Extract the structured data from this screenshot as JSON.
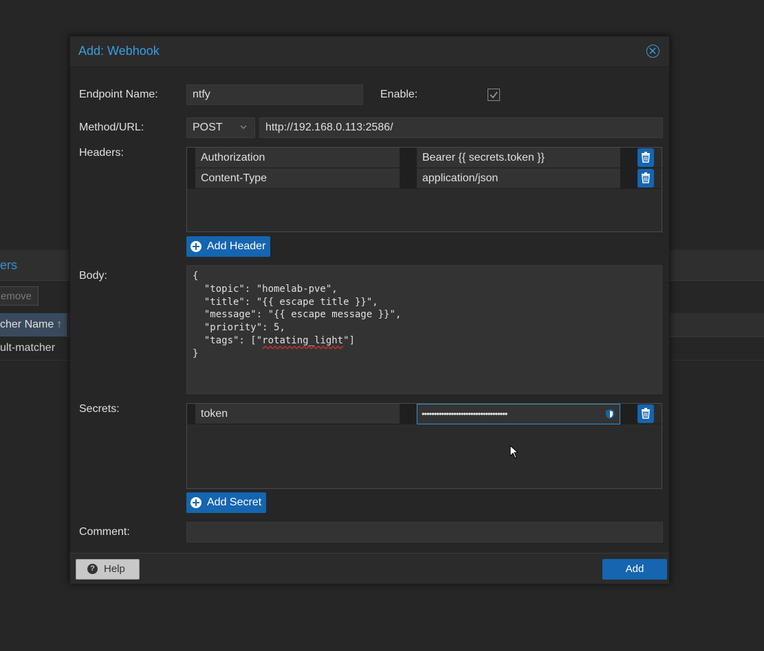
{
  "background": {
    "panel_title": "ers",
    "remove_label": "emove",
    "column_header": "cher Name",
    "column_sort": "↑",
    "row_value": "ult-matcher"
  },
  "dialog": {
    "title": "Add: Webhook",
    "endpoint_name_label": "Endpoint Name:",
    "endpoint_name_value": "ntfy",
    "enable_label": "Enable:",
    "enable_checked": true,
    "method_url_label": "Method/URL:",
    "method_value": "POST",
    "url_value": "http://192.168.0.113:2586/",
    "headers_label": "Headers:",
    "headers": [
      {
        "key": "Authorization",
        "value": "Bearer {{ secrets.token }}"
      },
      {
        "key": "Content-Type",
        "value": "application/json"
      }
    ],
    "add_header_label": "Add Header",
    "body_label": "Body:",
    "body_lines": [
      "{",
      "  \"topic\": \"homelab-pve\",",
      "  \"title\": \"{{ escape title }}\",",
      "  \"message\": \"{{ escape message }}\",",
      "  \"priority\": 5,",
      "  \"tags\": [\"",
      "rotating_light",
      "\"]",
      "}"
    ],
    "secrets_label": "Secrets:",
    "secrets": [
      {
        "key": "token",
        "value": "•••••••••••••••••••••••••••••••••••"
      }
    ],
    "add_secret_label": "Add Secret",
    "comment_label": "Comment:",
    "comment_value": "",
    "help_label": "Help",
    "add_label": "Add"
  },
  "colors": {
    "accent": "#3a9de0",
    "button_blue": "#1565b0",
    "background": "#262626"
  }
}
